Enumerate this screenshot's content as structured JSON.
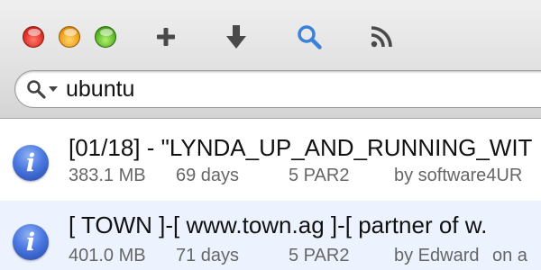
{
  "toolbar": {
    "buttons": [
      {
        "name": "add",
        "icon": "plus-icon"
      },
      {
        "name": "download",
        "icon": "download-arrow-icon"
      },
      {
        "name": "search",
        "icon": "search-icon",
        "active": true,
        "color": "#3b82d6"
      },
      {
        "name": "feeds",
        "icon": "rss-icon"
      }
    ]
  },
  "search": {
    "value": "ubuntu",
    "icon": "search-icon"
  },
  "results": [
    {
      "title": "[01/18] - \"LYNDA_UP_AND_RUNNING_WIT",
      "size": "383.1 MB",
      "age": "69 days",
      "par": "5 PAR2",
      "poster": "by software4UR",
      "group": ""
    },
    {
      "title": "[ TOWN ]-[ www.town.ag ]-[ partner of w.",
      "size": "401.0 MB",
      "age": "71 days",
      "par": "5 PAR2",
      "poster": "by Edward",
      "group": "on a"
    }
  ],
  "colors": {
    "accent": "#3b82d6",
    "selected_row": "#edf3fe",
    "info_icon": "#4a78e0"
  }
}
